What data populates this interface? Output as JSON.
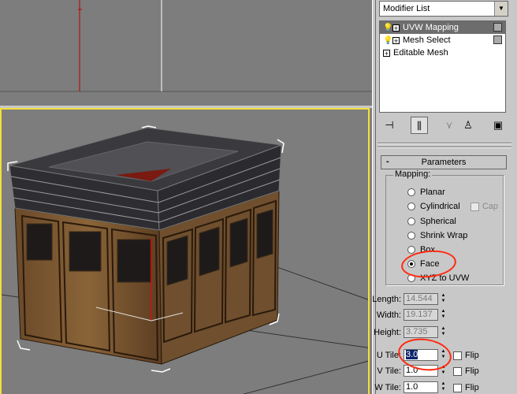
{
  "panel": {
    "modifier_list_label": "Modifier List",
    "stack": [
      {
        "label": "UVW Mapping",
        "selected": true,
        "bulb": true
      },
      {
        "label": "Mesh Select",
        "selected": false,
        "bulb": true
      },
      {
        "label": "Editable Mesh",
        "selected": false,
        "bulb": false
      }
    ],
    "rollout": {
      "minus": "-",
      "title": "Parameters"
    },
    "mapping": {
      "label": "Mapping:",
      "options": [
        {
          "label": "Planar",
          "selected": false
        },
        {
          "label": "Cylindrical",
          "selected": false
        },
        {
          "label": "Spherical",
          "selected": false
        },
        {
          "label": "Shrink Wrap",
          "selected": false
        },
        {
          "label": "Box",
          "selected": false
        },
        {
          "label": "Face",
          "selected": true
        },
        {
          "label": "XYZ to UVW",
          "selected": false
        }
      ],
      "cap_label": "Cap"
    },
    "fields": [
      {
        "label": "Length:",
        "value": "14.544"
      },
      {
        "label": "Width:",
        "value": "19.137"
      },
      {
        "label": "Height:",
        "value": "3.735"
      }
    ],
    "tiles": [
      {
        "label": "U Tile:",
        "value": "3.0",
        "flip": "Flip"
      },
      {
        "label": "V Tile:",
        "value": "1.0",
        "flip": "Flip"
      },
      {
        "label": "W Tile:",
        "value": "1.0",
        "flip": "Flip"
      }
    ]
  },
  "colors": {
    "viewport_bg": "#7d7d7d",
    "panel_bg": "#c8c8c8",
    "active_viewport_border": "#f2e03a",
    "annotation": "#ff2a10",
    "selection_bg": "#6d6d6d"
  },
  "icons": [
    "modifier-dropdown-arrow",
    "light-bulb-icon",
    "expand-plus-icon",
    "pin-stack-icon",
    "show-end-result-icon",
    "make-unique-icon",
    "remove-modifier-icon",
    "configure-sets-icon"
  ]
}
